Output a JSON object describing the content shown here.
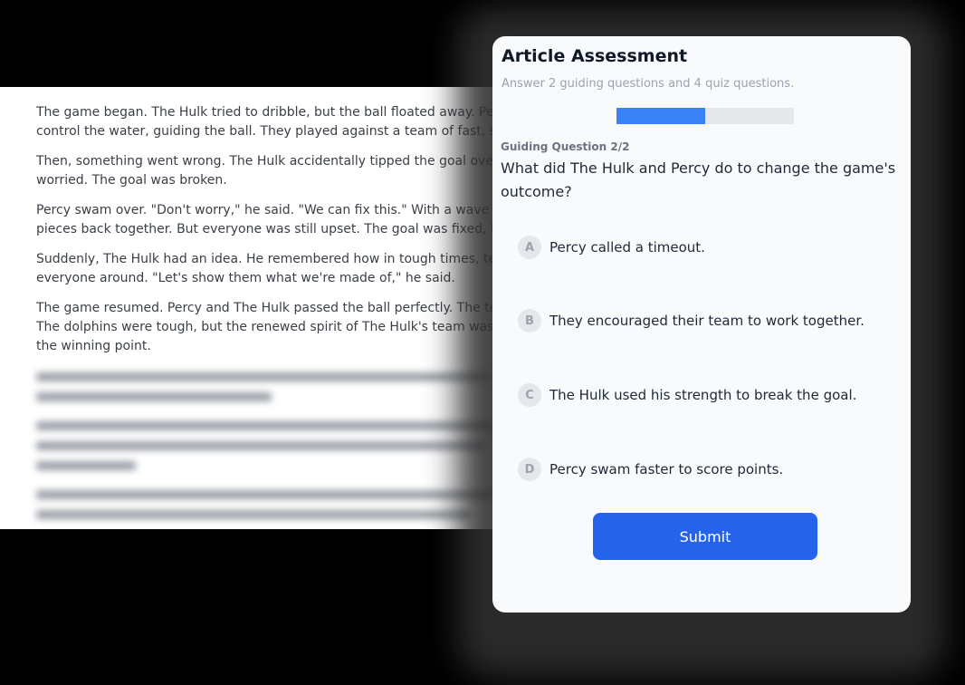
{
  "article": {
    "paragraphs": [
      {
        "lines": [
          "The game began. The Hulk tried to dribble, but the ball floated away. Percy",
          "control the water, guiding the ball. They played against a team of fast, skil"
        ]
      },
      {
        "lines": [
          "Then, something went wrong. The Hulk accidentally tipped the goal over.",
          "worried. The goal was broken."
        ]
      },
      {
        "lines": [
          "Percy swam over. \"Don't worry,\" he said. \"We can fix this.\" With a wave of",
          "pieces back together. But everyone was still upset. The goal was fixed, but"
        ]
      },
      {
        "lines": [
          "Suddenly, The Hulk had an idea. He remembered how in tough times, tean",
          "everyone around. \"Let's show them what we're made of,\" he said."
        ]
      },
      {
        "lines": [
          "The game resumed. Percy and The Hulk passed the ball perfectly. The tean",
          "The dolphins were tough, but the renewed spirit of The Hulk's team was to",
          "the winning point."
        ]
      }
    ]
  },
  "assessment": {
    "title": "Article Assessment",
    "subtitle": "Answer 2 guiding questions and 4 quiz questions.",
    "progress_fraction": 0.5,
    "question_label": "Guiding Question 2/2",
    "question_text": "What did The Hulk and Percy do to change the game's outcome?",
    "options": [
      {
        "letter": "A",
        "text": "Percy called a timeout."
      },
      {
        "letter": "B",
        "text": "They encouraged their team to work together."
      },
      {
        "letter": "C",
        "text": "The Hulk used his strength to break the goal."
      },
      {
        "letter": "D",
        "text": "Percy swam faster to score points."
      }
    ],
    "submit_label": "Submit"
  },
  "colors": {
    "accent": "#2563eb",
    "progress": "#3b82f6"
  }
}
